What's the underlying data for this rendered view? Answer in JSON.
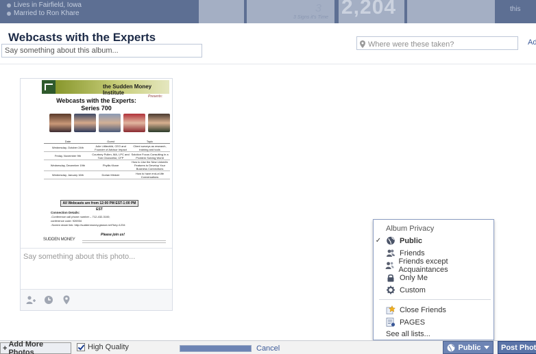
{
  "profile": {
    "lives_in": "Lives in Fairfield, Iowa",
    "married_to": "Married to Ron Khare"
  },
  "banner": {
    "small_number": "3",
    "big_number": "2,204",
    "tiny_text": "3 Signs it's Time",
    "right_text": "this"
  },
  "album": {
    "title": "Webcasts with the Experts",
    "description_placeholder": "Say something about this album...",
    "location_placeholder": "Where were these taken?",
    "add_link": "Ad"
  },
  "flyer": {
    "institute": "the Sudden Money Institute",
    "presents": "Presents:",
    "title_line1": "Webcasts with the Experts:",
    "title_line2": "Series 700",
    "table_headers": [
      "Date",
      "Guest",
      "Topic"
    ],
    "table_rows": [
      [
        "Wednesday, October 24th",
        "Julie Littlechild, CEO and Founder of Advisor Impact",
        "Client surveys as research, training and tools"
      ],
      [
        "Friday, November 9th",
        "Courtney Pullen, MA, LPC and Tom Chancellor, CFP",
        "Solution Focus Consulting in a Problem Solving World"
      ],
      [
        "Wednesday, December 19th",
        "Phyllis Khare",
        "How to Use the New LinkedIn Features to Develop Your Business Connections"
      ],
      [
        "Wednesday, January 16th",
        "Dorian Mintzer",
        "How to have end-of-life Conversations"
      ]
    ],
    "all_webcasts": "All Webcasts are from 12:00 PM EST-1:00 PM EST",
    "connection_title": "Connection Details:",
    "connection_lines": [
      "-Conference call phone number – 712-432-3100;",
      "conference code: 926934",
      "-Screen share link: http://suddenmoney.glance.net?key=1234"
    ],
    "join": "Please join us!",
    "logo": "SUDDEN MONEY"
  },
  "photo": {
    "caption_placeholder": "Say something about this photo..."
  },
  "privacy_menu": {
    "header": "Album Privacy",
    "items": [
      {
        "label": "Public",
        "icon": "globe-icon",
        "selected": true
      },
      {
        "label": "Friends",
        "icon": "friends-icon",
        "selected": false
      },
      {
        "label": "Friends except Acquaintances",
        "icon": "friends-except-icon",
        "selected": false
      },
      {
        "label": "Only Me",
        "icon": "lock-icon",
        "selected": false
      },
      {
        "label": "Custom",
        "icon": "gear-icon",
        "selected": false
      }
    ],
    "list_items": [
      {
        "label": "Close Friends",
        "icon": "star-icon"
      },
      {
        "label": "PAGES",
        "icon": "list-icon"
      }
    ],
    "see_all": "See all lists..."
  },
  "bottom": {
    "add_more": "Add More Photos",
    "high_quality": "High Quality",
    "cancel": "Cancel",
    "privacy_button": "Public",
    "post_button": "Post Photos",
    "upload_progress": 1.0
  },
  "colors": {
    "accent": "#3b5998",
    "button": "#6d84b4",
    "banner": "#5d6f93"
  }
}
